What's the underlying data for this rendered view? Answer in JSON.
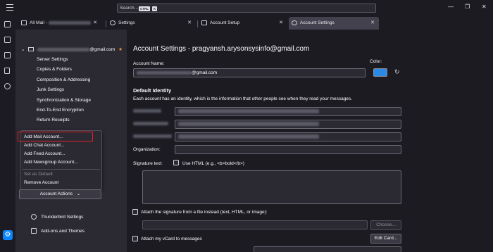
{
  "titlebar": {
    "search_placeholder": "Search...",
    "shortcut_key1": "CTRL",
    "shortcut_key2": "K",
    "window_min": "—",
    "window_max": "❐",
    "window_close": "✕"
  },
  "tabs": [
    {
      "label": "All Mail - ",
      "close": "✕"
    },
    {
      "label": "Settings",
      "close": "✕"
    },
    {
      "label": "Account Setup",
      "close": "✕"
    },
    {
      "label": "Account Settings",
      "close": "✕"
    }
  ],
  "sidebar": {
    "account_suffix": "@gmail.com",
    "star": "★",
    "twisty": "⌄",
    "items": [
      "Server Settings",
      "Copies & Folders",
      "Composition & Addressing",
      "Junk Settings",
      "Synchronization & Storage",
      "End-To-End Encryption",
      "Return Receipts"
    ],
    "context_menu": {
      "items": [
        "Add Mail Account...",
        "Add Chat Account...",
        "Add Feed Account...",
        "Add Newsgroup Account..."
      ],
      "set_default": "Set as Default",
      "remove": "Remove Account"
    },
    "account_actions": "Account Actions",
    "account_actions_chevron": "⌄",
    "footer": [
      "Thunderbird Settings",
      "Add-ons and Themes"
    ],
    "settings_gear": "⚙"
  },
  "main": {
    "title": "Account Settings - pragyansh.arysonsysinfo@gmail.com",
    "account_name_label": "Account Name:",
    "account_name_value": "@gmail.com",
    "color_label": "Color:",
    "accent_color": "#2b8ae6",
    "reset_icon": "↻",
    "identity_heading": "Default Identity",
    "identity_desc": "Each account has an identity, which is the information that other people see when they read your messages.",
    "organization_label": "Organization:",
    "signature_label": "Signature text:",
    "use_html_label": "Use HTML (e.g., <b>bold</b>)",
    "attach_sig_label": "Attach the signature from a file instead (text, HTML, or image):",
    "choose_button": "Choose...",
    "attach_vcard_label": "Attach my vCard to messages",
    "edit_card_button": "Edit Card..."
  }
}
